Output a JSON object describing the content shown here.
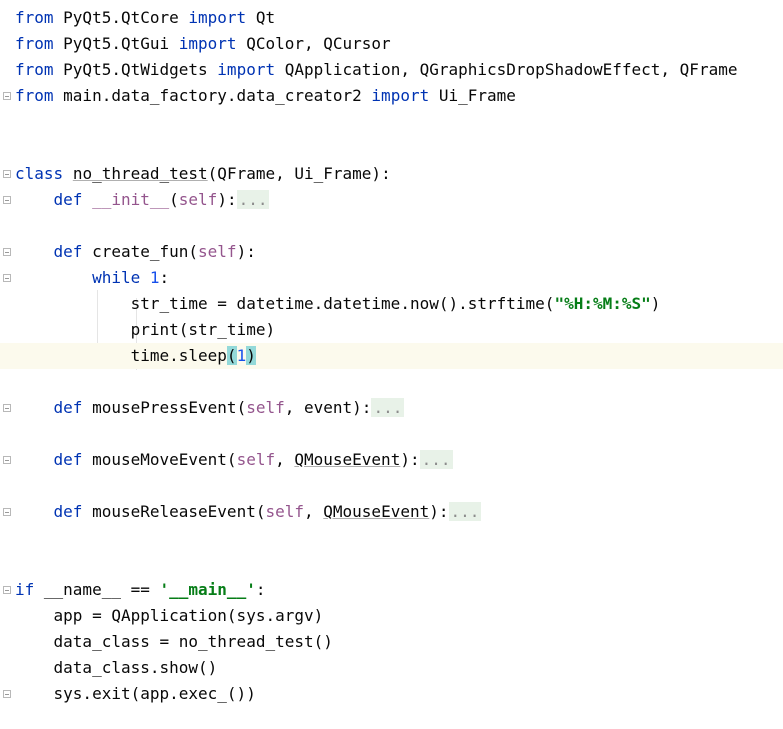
{
  "lines": [
    {
      "tokens": [
        {
          "t": "from",
          "c": "kw"
        },
        {
          "t": " PyQt5.QtCore ",
          "c": ""
        },
        {
          "t": "import",
          "c": "kw"
        },
        {
          "t": " Qt",
          "c": ""
        }
      ]
    },
    {
      "tokens": [
        {
          "t": "from",
          "c": "kw"
        },
        {
          "t": " PyQt5.QtGui ",
          "c": ""
        },
        {
          "t": "import",
          "c": "kw"
        },
        {
          "t": " QColor, QCursor",
          "c": ""
        }
      ]
    },
    {
      "tokens": [
        {
          "t": "from",
          "c": "kw"
        },
        {
          "t": " PyQt5.QtWidgets ",
          "c": ""
        },
        {
          "t": "import",
          "c": "kw"
        },
        {
          "t": " QApplication, QGraphicsDropShadowEffect, QFrame",
          "c": ""
        }
      ]
    },
    {
      "tokens": [
        {
          "t": "from",
          "c": "kw"
        },
        {
          "t": " main.data_factory.data_creator2 ",
          "c": ""
        },
        {
          "t": "import",
          "c": "kw"
        },
        {
          "t": " Ui_Frame",
          "c": ""
        }
      ]
    },
    {
      "tokens": []
    },
    {
      "tokens": []
    },
    {
      "tokens": [
        {
          "t": "class",
          "c": "kw"
        },
        {
          "t": " ",
          "c": ""
        },
        {
          "t": "no_thread_test",
          "c": "uline"
        },
        {
          "t": "(QFrame, Ui_Frame):",
          "c": ""
        }
      ]
    },
    {
      "tokens": [
        {
          "t": "    ",
          "c": ""
        },
        {
          "t": "def",
          "c": "kw"
        },
        {
          "t": " ",
          "c": ""
        },
        {
          "t": "__init__",
          "c": "self"
        },
        {
          "t": "(",
          "c": ""
        },
        {
          "t": "self",
          "c": "self"
        },
        {
          "t": "):",
          "c": ""
        },
        {
          "t": "...",
          "c": "fold-bg"
        }
      ]
    },
    {
      "tokens": []
    },
    {
      "tokens": [
        {
          "t": "    ",
          "c": ""
        },
        {
          "t": "def",
          "c": "kw"
        },
        {
          "t": " create_fun(",
          "c": ""
        },
        {
          "t": "self",
          "c": "self"
        },
        {
          "t": "):",
          "c": ""
        }
      ]
    },
    {
      "tokens": [
        {
          "t": "        ",
          "c": ""
        },
        {
          "t": "while",
          "c": "kw"
        },
        {
          "t": " ",
          "c": ""
        },
        {
          "t": "1",
          "c": "num"
        },
        {
          "t": ":",
          "c": ""
        }
      ]
    },
    {
      "tokens": [
        {
          "t": "            str_time = datetime.datetime.now().strftime(",
          "c": ""
        },
        {
          "t": "\"%H:%M:%S\"",
          "c": "str"
        },
        {
          "t": ")",
          "c": ""
        }
      ]
    },
    {
      "tokens": [
        {
          "t": "            print(str_time)",
          "c": ""
        }
      ]
    },
    {
      "current": true,
      "tokens": [
        {
          "t": "            time.sleep",
          "c": ""
        },
        {
          "t": "(",
          "c": "paren-hl"
        },
        {
          "t": "1",
          "c": "num"
        },
        {
          "t": ")",
          "c": "paren-hl"
        }
      ]
    },
    {
      "tokens": []
    },
    {
      "tokens": [
        {
          "t": "    ",
          "c": ""
        },
        {
          "t": "def",
          "c": "kw"
        },
        {
          "t": " mousePressEvent(",
          "c": ""
        },
        {
          "t": "self",
          "c": "self"
        },
        {
          "t": ", event):",
          "c": ""
        },
        {
          "t": "...",
          "c": "fold-bg"
        }
      ]
    },
    {
      "tokens": []
    },
    {
      "tokens": [
        {
          "t": "    ",
          "c": ""
        },
        {
          "t": "def",
          "c": "kw"
        },
        {
          "t": " mouseMoveEvent(",
          "c": ""
        },
        {
          "t": "self",
          "c": "self"
        },
        {
          "t": ", ",
          "c": ""
        },
        {
          "t": "QMouseEvent",
          "c": "uline"
        },
        {
          "t": "):",
          "c": ""
        },
        {
          "t": "...",
          "c": "fold-bg"
        }
      ]
    },
    {
      "tokens": []
    },
    {
      "tokens": [
        {
          "t": "    ",
          "c": ""
        },
        {
          "t": "def",
          "c": "kw"
        },
        {
          "t": " mouseReleaseEvent(",
          "c": ""
        },
        {
          "t": "self",
          "c": "self"
        },
        {
          "t": ", ",
          "c": ""
        },
        {
          "t": "QMouseEvent",
          "c": "uline"
        },
        {
          "t": "):",
          "c": ""
        },
        {
          "t": "...",
          "c": "fold-bg"
        }
      ]
    },
    {
      "tokens": []
    },
    {
      "tokens": []
    },
    {
      "tokens": [
        {
          "t": "if",
          "c": "kw"
        },
        {
          "t": " __name__ == ",
          "c": ""
        },
        {
          "t": "'__main__'",
          "c": "str"
        },
        {
          "t": ":",
          "c": ""
        }
      ]
    },
    {
      "tokens": [
        {
          "t": "    app = QApplication(sys.argv)",
          "c": ""
        }
      ]
    },
    {
      "tokens": [
        {
          "t": "    data_class = no_thread_test()",
          "c": ""
        }
      ]
    },
    {
      "tokens": [
        {
          "t": "    data_class.show()",
          "c": ""
        }
      ]
    },
    {
      "tokens": [
        {
          "t": "    sys.exit(app.exec_())",
          "c": ""
        }
      ]
    }
  ],
  "fold_markers": [
    3,
    6,
    7,
    9,
    10,
    13,
    15,
    17,
    19,
    22,
    26
  ]
}
